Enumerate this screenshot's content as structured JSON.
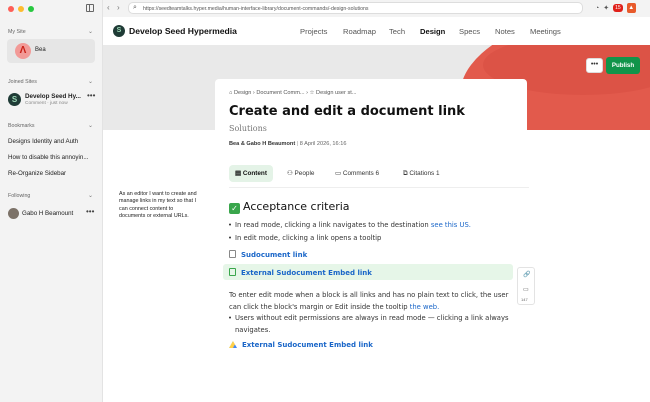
{
  "sidebar": {
    "my_site_label": "My Site",
    "site_name": "Bea",
    "site_initial": "Λ",
    "joined_label": "Joined Sites",
    "joined_site": {
      "name": "Develop Seed Hy...",
      "sub": "Comment · just now"
    },
    "bookmarks_label": "Bookmarks",
    "bookmarks": [
      "Designs Identity and Auth",
      "How to disable this annoyin...",
      "Re-Organize Sidebar"
    ],
    "following_label": "Following",
    "following": [
      "Gabo H Beamount"
    ]
  },
  "browser": {
    "url": "https://seedteamtalks.hyper.media/human-interface-library/document-commands/-design-solutions",
    "badge_count": "15"
  },
  "header": {
    "site_title": "Develop Seed Hypermedia",
    "nav": [
      "Projects",
      "Roadmap",
      "Tech",
      "Design",
      "Specs",
      "Notes",
      "Meetings"
    ],
    "active_nav": "Design",
    "more_label": "•••",
    "publish_label": "Publish"
  },
  "doc": {
    "breadcrumb": "Design › Document Comm... › ☆ Design user st...",
    "title": "Create and edit a document link",
    "subtitle": "Solutions",
    "authors": "Bea & Gabo H Beaumont",
    "date": "8 April 2026, 16:16",
    "tabs": [
      {
        "label": "Content",
        "count": ""
      },
      {
        "label": "People",
        "count": ""
      },
      {
        "label": "Comments",
        "count": "6"
      },
      {
        "label": "Citations",
        "count": "1"
      }
    ],
    "heading": "Acceptance criteria",
    "bullet1_pre": "In read mode, clicking a link navigates to the destination ",
    "bullet1_link": "see this US.",
    "bullet2": "In edit mode, clicking a link opens a tooltip",
    "embed1": "Sudocument link",
    "embed2": "External Sudocument Embed link",
    "para_line1": "To enter edit mode when a block is all links and has no plain text to click, the user",
    "para_line2_pre": "can click the block's margin or Edit inside the tooltip ",
    "para_line2_link": "the web.",
    "bullet3_line1": "Users without edit permissions are always in read mode — clicking a link always",
    "bullet3_line2": "navigates.",
    "embed3": "External Sudocument Embed link",
    "tool_count": "147"
  },
  "side_note": "As an editor I want to create and manage links in my text so that I can connect content to documents or external URLs.",
  "colors": {
    "publish": "#11944a",
    "link": "#1a66c8",
    "banner": "#e25a4c",
    "highlight": "#e6f6e8"
  }
}
